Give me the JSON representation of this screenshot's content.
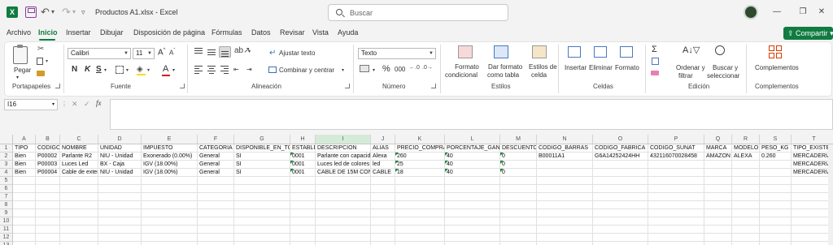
{
  "titlebar": {
    "doc_title": "Productos A1.xlsx  -  Excel",
    "search_placeholder": "Buscar",
    "logo_letter": "X"
  },
  "menu": {
    "tabs": [
      "Archivo",
      "Inicio",
      "Insertar",
      "Dibujar",
      "Disposición de página",
      "Fórmulas",
      "Datos",
      "Revisar",
      "Vista",
      "Ayuda"
    ],
    "active": "Inicio",
    "share_label": "Compartir"
  },
  "ribbon": {
    "clipboard": {
      "paste_label": "Pegar",
      "group_label": "Portapapeles"
    },
    "font": {
      "font_name": "Calibri",
      "font_size": "11",
      "group_label": "Fuente",
      "bold": "N",
      "italic": "K",
      "underline": "S"
    },
    "alignment": {
      "wrap_label": "Ajustar texto",
      "merge_label": "Combinar y centrar",
      "group_label": "Alineación"
    },
    "number": {
      "format": "Texto",
      "group_label": "Número",
      "percent": "%",
      "thousands": "000"
    },
    "styles": {
      "conditional": [
        "Formato",
        "condicional"
      ],
      "table": [
        "Dar formato",
        "como tabla"
      ],
      "cell_styles": [
        "Estilos de",
        "celda"
      ],
      "group_label": "Estilos"
    },
    "cells": {
      "insert": "Insertar",
      "delete": "Eliminar",
      "format": "Formato",
      "group_label": "Celdas"
    },
    "editing": {
      "sort": [
        "Ordenar y",
        "filtrar"
      ],
      "find": [
        "Buscar y",
        "seleccionar"
      ],
      "group_label": "Edición"
    },
    "addins": {
      "label": "Complementos",
      "group_label": "Complementos"
    }
  },
  "formula_bar": {
    "name_box": "I16",
    "fx": "fx",
    "content": ""
  },
  "sheet": {
    "columns": [
      "A",
      "B",
      "C",
      "D",
      "E",
      "F",
      "G",
      "H",
      "I",
      "J",
      "K",
      "L",
      "M",
      "N",
      "O",
      "P",
      "Q",
      "R",
      "S",
      "T"
    ],
    "row_numbers": [
      "1",
      "2",
      "3",
      "4",
      "5",
      "6",
      "7",
      "8",
      "9",
      "10",
      "11",
      "12",
      "13"
    ],
    "rows": [
      [
        "TIPO",
        "CODIGO",
        "NOMBRE",
        "UNIDAD",
        "IMPUESTO",
        "CATEGORIA",
        "DISPONIBLE_EN_TOTAL",
        "ESTABLECIMIENTO",
        "DESCRIPCION",
        "ALIAS",
        "PRECIO_COMPRA",
        "PORCENTAJE_GANANCIA",
        "DESCUENTO",
        "CODIGO_BARRAS",
        "CODIGO_FABRICA",
        "CODIGO_SUNAT",
        "MARCA",
        "MODELO",
        "PESO_KG",
        "TIPO_EXISTENCIA"
      ],
      [
        "Bien",
        "P00002",
        "Parlante R2",
        "NIU - Unidad",
        "Exonerado (0.00%)",
        "General",
        "SI",
        "0001",
        "Parlante con capacidad",
        "Alexa",
        "260",
        "40",
        "0",
        "B00011A1",
        "G6A14252424HH",
        "432116070028458",
        "AMAZON",
        "ALEXA",
        "0.260",
        "MERCADERIAS"
      ],
      [
        "Bien",
        "P00003",
        "Luces Led",
        "BX - Caja",
        "IGV (18.00%)",
        "General",
        "SI",
        "0001",
        "Luces led de colores",
        "led",
        "25",
        "40",
        "0",
        "",
        "",
        "",
        "",
        "",
        "",
        "MERCADERIAS"
      ],
      [
        "Bien",
        "P00004",
        "Cable de extension",
        "NIU - Unidad",
        "IGV (18.00%)",
        "General",
        "SI",
        "0001",
        "CABLE DE 15M CON",
        "CABLE",
        "18",
        "40",
        "0",
        "",
        "",
        "",
        "",
        "",
        "",
        "MERCADERIAS"
      ]
    ]
  },
  "colors": {
    "accent": "#107c41"
  }
}
